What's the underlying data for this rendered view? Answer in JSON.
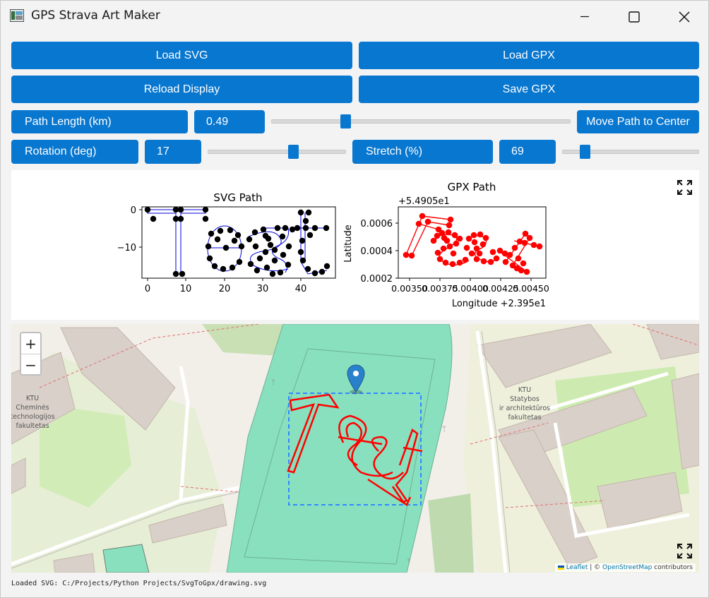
{
  "window": {
    "title": "GPS Strava Art Maker"
  },
  "buttons": {
    "load_svg": "Load SVG",
    "load_gpx": "Load GPX",
    "reload_display": "Reload Display",
    "save_gpx": "Save GPX",
    "move_center": "Move Path to Center"
  },
  "controls": {
    "path_length": {
      "label": "Path Length (km)",
      "value": "0.49",
      "slider_fraction": 0.24
    },
    "rotation": {
      "label": "Rotation (deg)",
      "value": "17",
      "slider_fraction": 0.63
    },
    "stretch": {
      "label": "Stretch (%)",
      "value": "69",
      "slider_fraction": 0.14
    }
  },
  "plots": {
    "svg_plot": {
      "title": "SVG Path",
      "x_ticks": [
        "0",
        "10",
        "20",
        "30",
        "40"
      ],
      "y_ticks": [
        "0",
        "−10"
      ]
    },
    "gpx_plot": {
      "title": "GPX Path",
      "offset_label": "+5.4905e1",
      "x_ticks": [
        "0.00350",
        "0.00375",
        "0.00400",
        "0.00425",
        "0.00450"
      ],
      "y_ticks": [
        "0.0006",
        "0.0004",
        "0.0002"
      ],
      "xlabel": "Longitude +2.395e1",
      "ylabel": "Latitude"
    }
  },
  "map": {
    "zoom_in": "+",
    "zoom_out": "−",
    "labels": {
      "left_building": [
        "KTU",
        "Cheminės",
        "technologijos",
        "fakultetas"
      ],
      "right_building": [
        "KTU",
        "Statybos",
        "ir architektūros",
        "fakultetas"
      ]
    },
    "drawn_text": "Test",
    "attribution": {
      "leaflet": "Leaflet",
      "separator": " | © ",
      "osm": "OpenStreetMap",
      "suffix": " contributors"
    },
    "colors": {
      "path": "#ff0000",
      "selection": "#3388ff",
      "marker": "#2a81cb"
    }
  },
  "status": {
    "text": "Loaded SVG: C:/Projects/Python Projects/SvgToGpx/drawing.svg"
  },
  "icons": {
    "fullscreen": "fullscreen-icon",
    "minimize": "minimize-icon",
    "maximize": "maximize-icon",
    "close": "close-icon",
    "marker": "map-marker-icon"
  },
  "accent": "#0877d0"
}
